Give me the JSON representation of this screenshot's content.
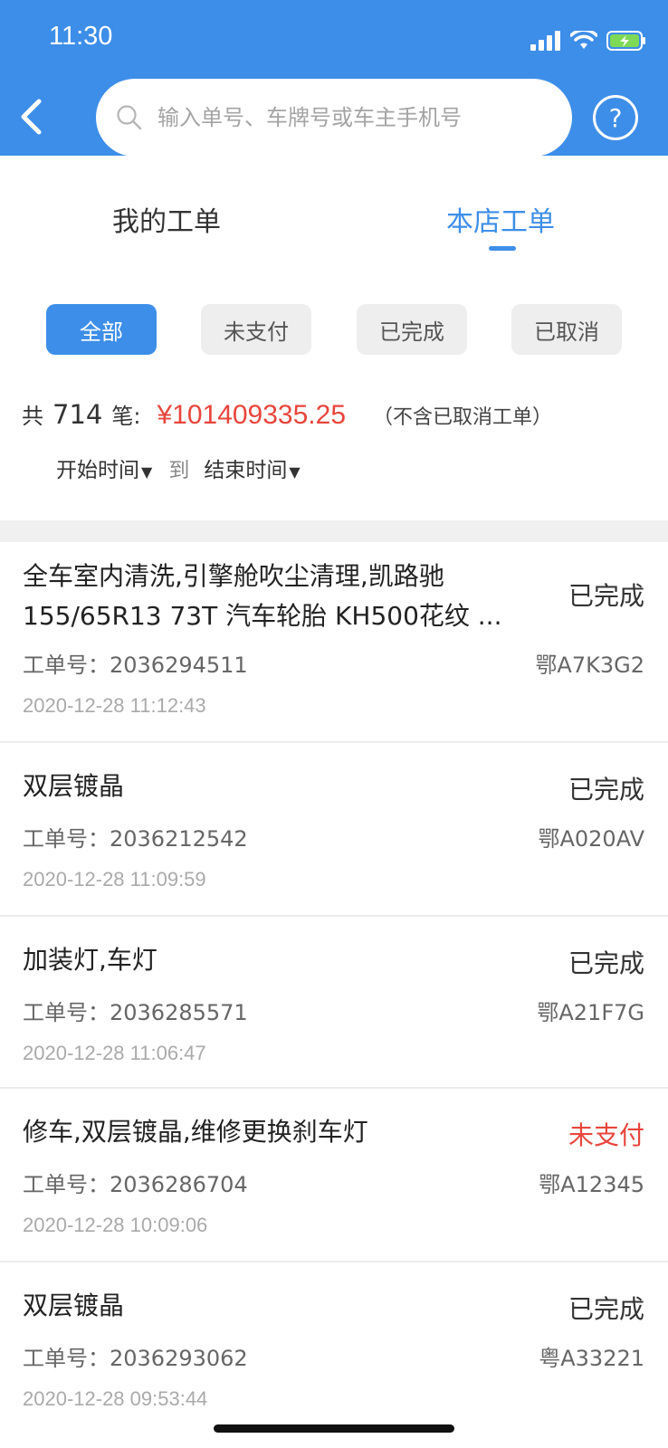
{
  "status_bar": {
    "time": "11:30"
  },
  "header": {
    "search_placeholder": "输入单号、车牌号或车主手机号",
    "help_label": "?"
  },
  "tabs": [
    {
      "label": "我的工单",
      "active": false
    },
    {
      "label": "本店工单",
      "active": true
    }
  ],
  "filters": [
    {
      "label": "全部",
      "active": true
    },
    {
      "label": "未支付",
      "active": false
    },
    {
      "label": "已完成",
      "active": false
    },
    {
      "label": "已取消",
      "active": false
    }
  ],
  "summary": {
    "prefix": "共",
    "count": "714",
    "suffix": "笔:",
    "amount": "¥101409335.25",
    "note": "（不含已取消工单）"
  },
  "date_range": {
    "start_label": "开始时间",
    "to_label": "到",
    "end_label": "结束时间"
  },
  "orders": [
    {
      "title": "全车室内清洗,引擎舱吹尘清理,凯路驰155/65R13 73T 汽车轮胎 KH500花纹 ...",
      "status": "已完成",
      "order_no": "工单号：2036294511",
      "plate": "鄂A7K3G2",
      "time": "2020-12-28 11:12:43"
    },
    {
      "title": "双层镀晶",
      "status": "已完成",
      "order_no": "工单号：2036212542",
      "plate": "鄂A020AV",
      "time": "2020-12-28 11:09:59"
    },
    {
      "title": "加装灯,车灯",
      "status": "已完成",
      "order_no": "工单号：2036285571",
      "plate": "鄂A21F7G",
      "time": "2020-12-28 11:06:47"
    },
    {
      "title": "修车,双层镀晶,维修更换刹车灯",
      "status": "未支付",
      "order_no": "工单号：2036286704",
      "plate": "鄂A12345",
      "time": "2020-12-28 10:09:06"
    },
    {
      "title": "双层镀晶",
      "status": "已完成",
      "order_no": "工单号：2036293062",
      "plate": "粤A33221",
      "time": "2020-12-28 09:53:44"
    }
  ],
  "colors": {
    "brand": "#3d8ee8",
    "unpaid": "#e8453c",
    "amount": "#e8453c"
  }
}
